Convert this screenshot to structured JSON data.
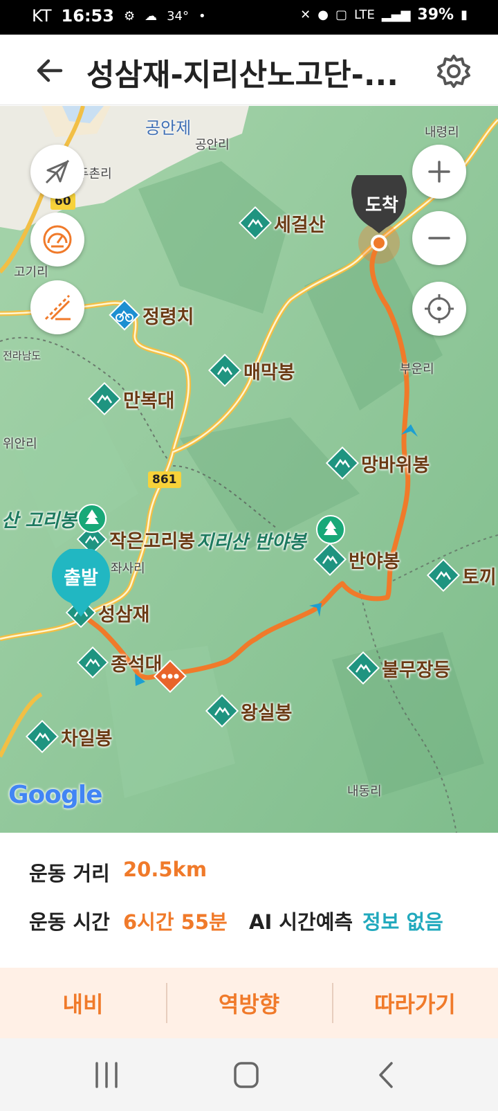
{
  "status": {
    "carrier": "KT",
    "time": "16:53",
    "temperature": "34°",
    "dot": "•",
    "network": "LTE",
    "battery": "39%"
  },
  "header": {
    "title": "성삼재-지리산노고단-...",
    "back_icon": "back-arrow-icon",
    "settings_icon": "gear-icon"
  },
  "map": {
    "arrival_label": "도착",
    "start_label": "출발",
    "controls": [
      "navigation-off-icon",
      "speedometer-icon",
      "slope-icon",
      "zoom-in-icon",
      "zoom-out-icon",
      "locate-icon"
    ],
    "road_numbers": [
      "60",
      "861"
    ],
    "villages": [
      "공안제",
      "공안리",
      "내령리",
      "두촌리",
      "고기리",
      "전라남도",
      "위안리",
      "부운리",
      "좌사리",
      "내동리"
    ],
    "peaks": [
      "세걸산",
      "정령치",
      "매막봉",
      "만복대",
      "망바위봉",
      "작은고리봉",
      "지리산 반야봉",
      "반야봉",
      "토끼",
      "성삼재",
      "종석대",
      "불무장등",
      "왕실봉",
      "차일봉"
    ],
    "forest_label": "산 고리봉",
    "attribution": "Google"
  },
  "stats": {
    "distance_label": "운동 거리",
    "distance_value": "20.5km",
    "time_label": "운동 시간",
    "time_value": "6시간 55분",
    "ai_label": "AI 시간예측",
    "ai_value": "정보 없음"
  },
  "actions": {
    "navi": "내비",
    "reverse": "역방향",
    "follow": "따라가기"
  },
  "colors": {
    "accent": "#f07a2a",
    "teal": "#21a9bd",
    "map_green": "#8fc79a"
  }
}
